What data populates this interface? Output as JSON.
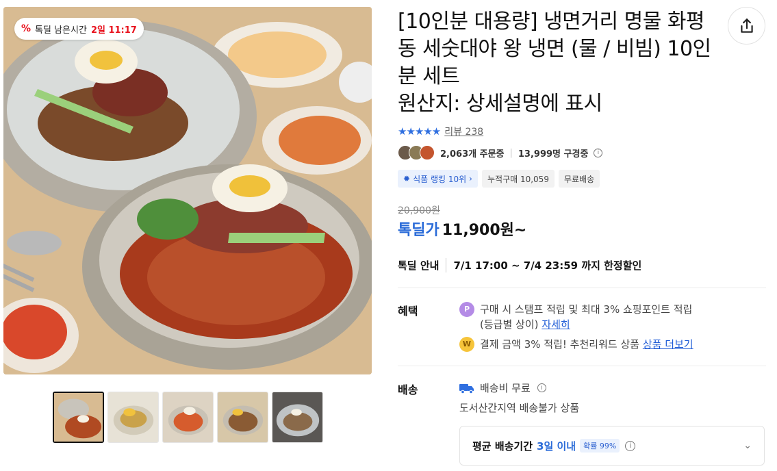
{
  "timer": {
    "label": "톡딜 남은시간",
    "value": "2일 11:17"
  },
  "product": {
    "title": "[10인분 대용량] 냉면거리 명물 화평동 세숫대야 왕 냉면 (물 / 비빔) 10인분 세트",
    "origin": "원산지: 상세설명에 표시"
  },
  "rating": {
    "stars": "★★★★★",
    "review_label": "리뷰 238"
  },
  "orders": {
    "order_count": "2,063개 주문중",
    "viewer_count": "13,999명 구경중"
  },
  "tags": [
    "식품 랭킹 10위",
    "누적구매 10,059",
    "무료배송"
  ],
  "price": {
    "original": "20,900원",
    "deal_label": "톡딜가",
    "deal_price": "11,900원~"
  },
  "deal_guide": {
    "label": "톡딜 안내",
    "text": "7/1 17:00 ~ 7/4 23:59 까지 한정할인"
  },
  "benefits": {
    "label": "혜택",
    "line1": "구매 시 스탬프 적립 및 최대 3% 쇼핑포인트 적립",
    "line1b": "(등급별 상이)",
    "line1_link": "자세히",
    "line2": "결제 금액 3% 적립! 추천리워드 상품",
    "line2_link": "상품 더보기"
  },
  "shipping": {
    "label": "배송",
    "fee": "배송비 무료",
    "note": "도서산간지역 배송불가 상품",
    "avg_label": "평균 배송기간",
    "avg_days": "3일 이내",
    "prob": "확률 99%"
  },
  "icons": [
    "percent-icon",
    "share-icon",
    "star-icon",
    "info-icon",
    "gear-icon",
    "chevron-right-icon",
    "coin-p-icon",
    "coin-w-icon",
    "truck-icon",
    "chevron-down-icon"
  ],
  "colors": {
    "accent_blue": "#2a6bd8",
    "timer_red": "#e8121d"
  }
}
